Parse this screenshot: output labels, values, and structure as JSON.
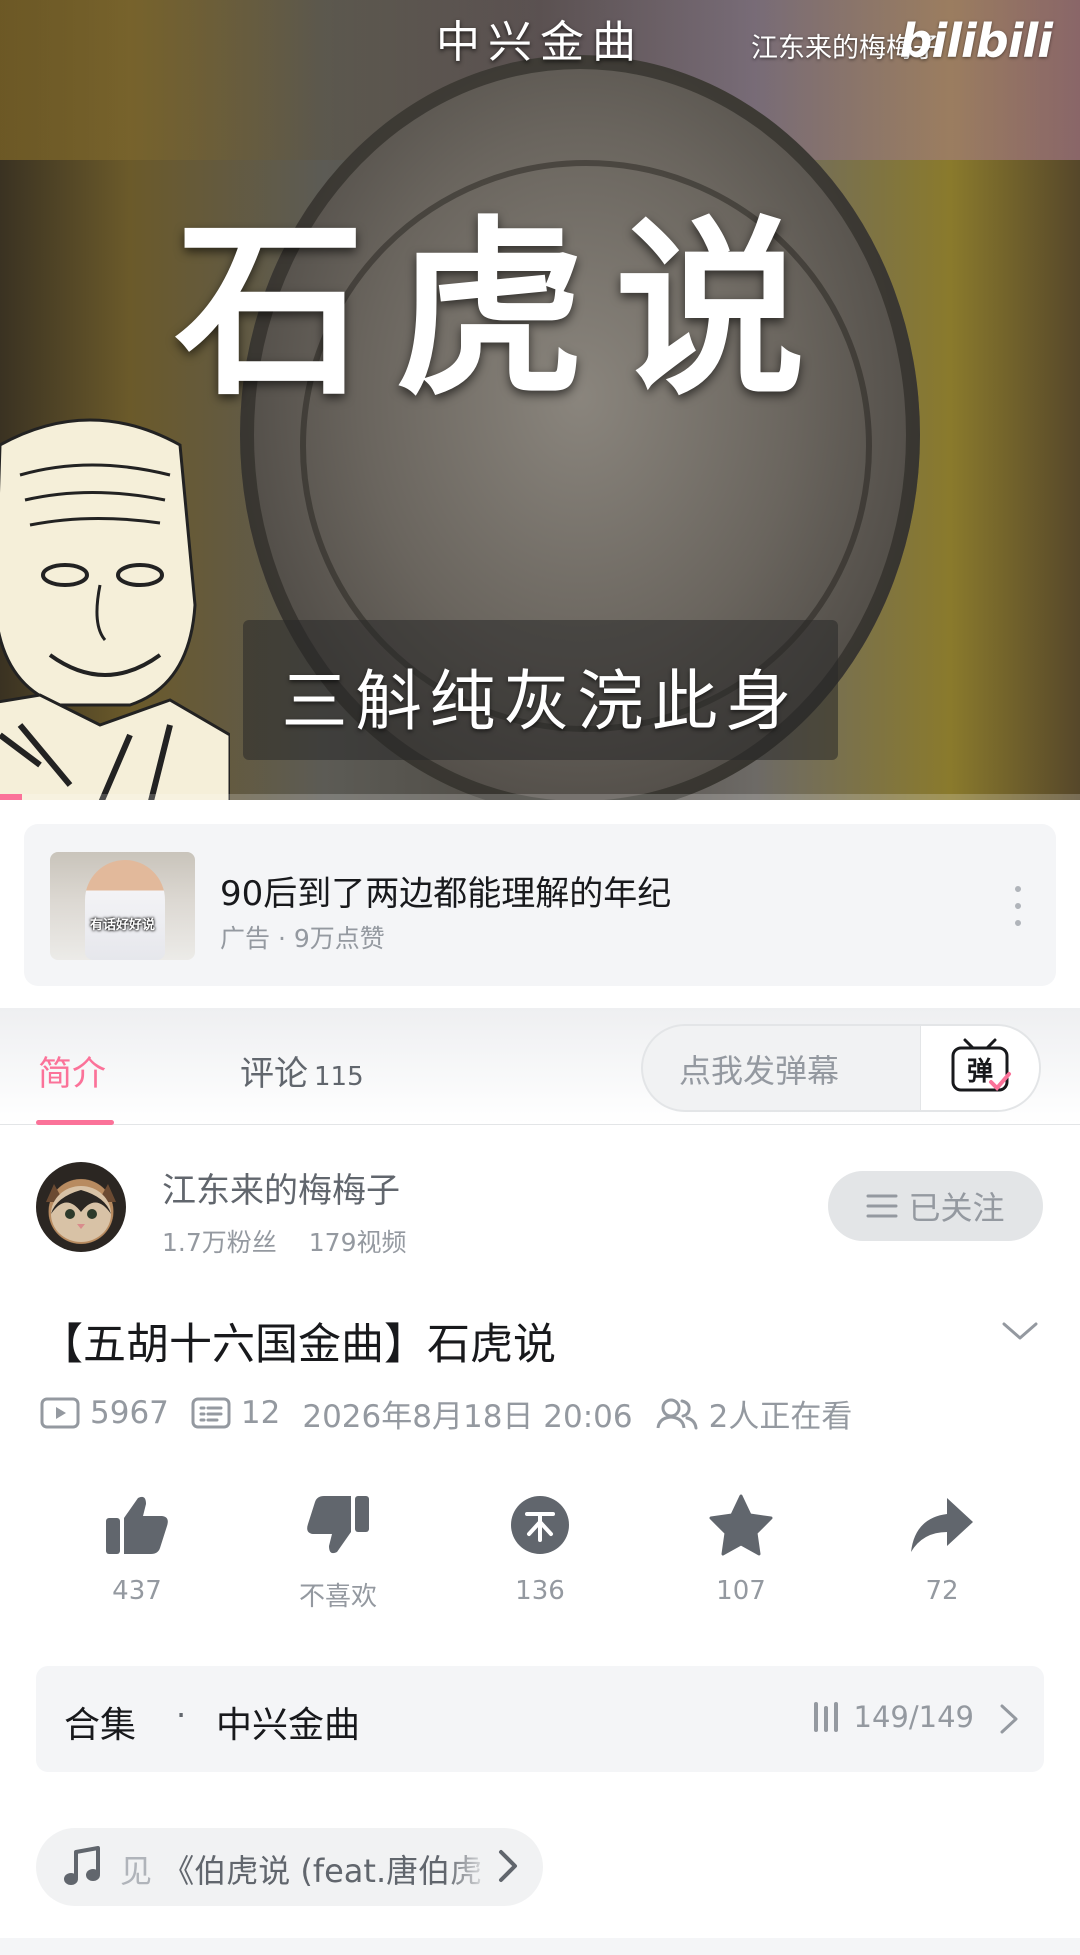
{
  "video": {
    "top_title": "中兴金曲",
    "uploader_watermark": "江东来的梅梅子",
    "platform_logo": "bilibili",
    "big_title": "石虎说",
    "subtitle": "三斛纯灰浣此身",
    "progress": 0.02
  },
  "ad": {
    "thumb_caption": "有话好好说",
    "title": "90后到了两边都能理解的年纪",
    "meta": "广告 · 9万点赞"
  },
  "tabs": {
    "intro": "简介",
    "comments": "评论",
    "comments_count": "115",
    "danmaku_placeholder": "点我发弹幕",
    "danmaku_icon": "danmaku-send-icon"
  },
  "uploader": {
    "name": "江东来的梅梅子",
    "fans": "1.7万粉丝",
    "videos": "179视频",
    "follow_label": "已关注"
  },
  "video_info": {
    "title": "【五胡十六国金曲】石虎说",
    "plays": "5967",
    "danmaku_count": "12",
    "date": "2026年8月18日 20:06",
    "watching": "2人正在看"
  },
  "actions": {
    "like": "437",
    "dislike": "不喜欢",
    "coin": "136",
    "favorite": "107",
    "share": "72"
  },
  "collection": {
    "label": "合集",
    "separator": "·",
    "name": "中兴金曲",
    "progress": "149/149"
  },
  "music": {
    "prefix": "见",
    "title": "《伯虎说 (feat.唐伯虎"
  },
  "colors": {
    "accent": "#fb7299",
    "icon_gray": "#61666d",
    "text_gray": "#9499a0"
  }
}
